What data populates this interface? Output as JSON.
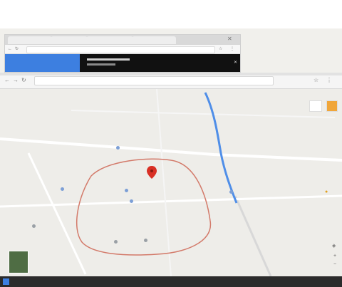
{
  "screen": {
    "top_window": {
      "tabs": [
        "",
        "",
        "",
        ""
      ],
      "url": "",
      "blue_panel_text": "",
      "dark_panel_text": ""
    },
    "browser": {
      "url": ""
    },
    "map": {
      "labels": [
        "",
        "",
        "",
        "",
        "",
        "",
        "",
        "",
        "",
        "",
        "",
        "",
        "",
        "",
        "",
        "",
        "",
        "",
        "",
        "",
        "",
        "",
        ""
      ]
    }
  },
  "colors": {
    "map_bg": "#eeede9",
    "water": "#4f8ee8",
    "circle": "#d37a6a",
    "marker": "#d93025",
    "chrome_blue": "#3d7fe0",
    "taskbar": "#2b2b2b"
  },
  "icons": [
    "back-icon",
    "forward-icon",
    "reload-icon",
    "star-icon",
    "menu-icon",
    "map-pin-icon",
    "zoom-in-icon",
    "zoom-out-icon",
    "pegman-icon",
    "compass-icon"
  ]
}
